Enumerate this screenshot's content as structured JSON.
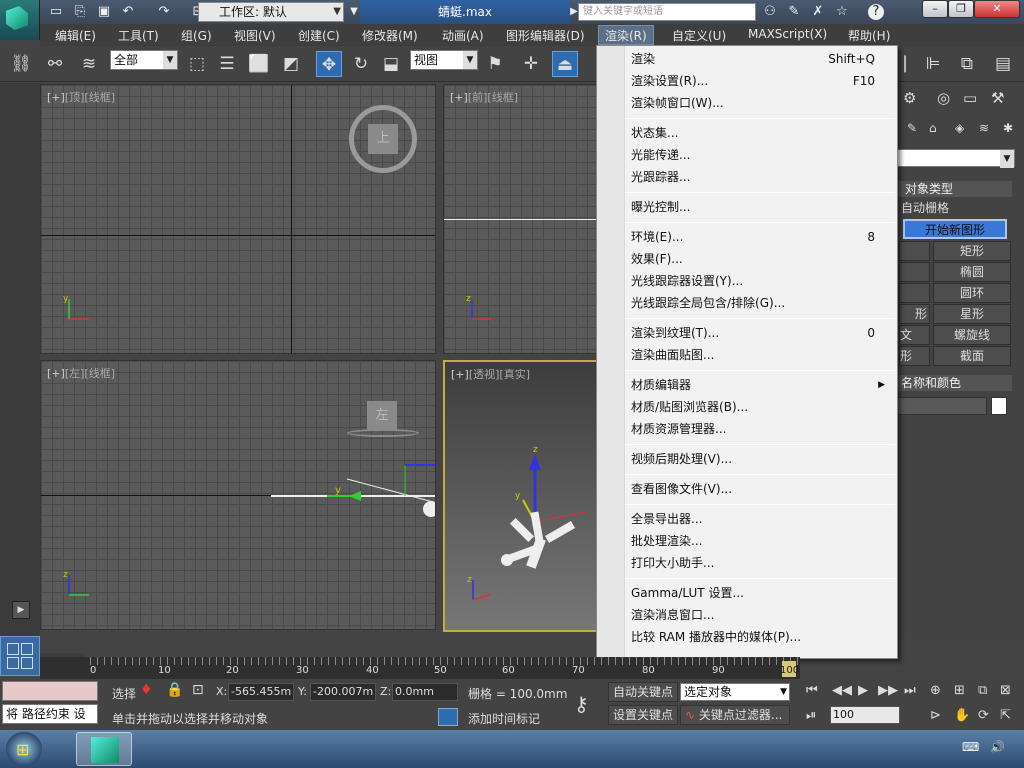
{
  "title_bar": {
    "workspace_label": "工作区: 默认",
    "filename": "蜻蜓.max",
    "search_placeholder": "键入关键字或短语"
  },
  "menu_bar": {
    "items": [
      "编辑(E)",
      "工具(T)",
      "组(G)",
      "视图(V)",
      "创建(C)",
      "修改器(M)",
      "动画(A)",
      "图形编辑器(D)",
      "渲染(R)",
      "自定义(U)",
      "MAXScript(X)",
      "帮助(H)"
    ],
    "active_index": 8
  },
  "toolbar": {
    "selection_filter": "全部",
    "ref_coord": "视图"
  },
  "viewports": {
    "top": {
      "plus": "[+]",
      "name": "[顶]",
      "mode": "[线框]",
      "cube_label": "上"
    },
    "front": {
      "plus": "[+]",
      "name": "[前]",
      "mode": "[线框]"
    },
    "left": {
      "plus": "[+]",
      "name": "[左]",
      "mode": "[线框]",
      "cube_label": "左"
    },
    "perspective": {
      "plus": "[+]",
      "name": "[透视]",
      "mode": "[真实]"
    },
    "axis_labels": {
      "x": "x",
      "y": "y",
      "z": "z"
    }
  },
  "render_menu": {
    "groups": [
      [
        {
          "label": "渲染",
          "shortcut": "Shift+Q"
        },
        {
          "label": "渲染设置(R)...",
          "shortcut": "F10"
        },
        {
          "label": "渲染帧窗口(W)...",
          "shortcut": ""
        }
      ],
      [
        {
          "label": "状态集...",
          "shortcut": ""
        },
        {
          "label": "光能传递...",
          "shortcut": ""
        },
        {
          "label": "光跟踪器...",
          "shortcut": ""
        }
      ],
      [
        {
          "label": "曝光控制...",
          "shortcut": ""
        }
      ],
      [
        {
          "label": "环境(E)...",
          "shortcut": "8"
        },
        {
          "label": "效果(F)...",
          "shortcut": ""
        },
        {
          "label": "光线跟踪器设置(Y)...",
          "shortcut": ""
        },
        {
          "label": "光线跟踪全局包含/排除(G)...",
          "shortcut": ""
        }
      ],
      [
        {
          "label": "渲染到纹理(T)...",
          "shortcut": "0"
        },
        {
          "label": "渲染曲面贴图...",
          "shortcut": ""
        }
      ],
      [
        {
          "label": "材质编辑器",
          "shortcut": "",
          "submenu": true
        },
        {
          "label": "材质/贴图浏览器(B)...",
          "shortcut": ""
        },
        {
          "label": "材质资源管理器...",
          "shortcut": ""
        }
      ],
      [
        {
          "label": "视频后期处理(V)...",
          "shortcut": ""
        }
      ],
      [
        {
          "label": "查看图像文件(V)...",
          "shortcut": ""
        }
      ],
      [
        {
          "label": "全景导出器...",
          "shortcut": ""
        },
        {
          "label": "批处理渲染...",
          "shortcut": ""
        },
        {
          "label": "打印大小助手...",
          "shortcut": ""
        }
      ],
      [
        {
          "label": "Gamma/LUT 设置...",
          "shortcut": ""
        },
        {
          "label": "渲染消息窗口...",
          "shortcut": ""
        },
        {
          "label": "比较 RAM 播放器中的媒体(P)...",
          "shortcut": ""
        }
      ]
    ]
  },
  "command_panel": {
    "object_type_header": "对象类型",
    "auto_grid": "自动栅格",
    "start_new_shape": "开始新图形",
    "shape_buttons": [
      "矩形",
      "椭圆",
      "圆环",
      "星形",
      "螺旋线",
      "截面"
    ],
    "left_partial": [
      "",
      "",
      "",
      "形",
      "文",
      "形"
    ],
    "name_color_header": "名称和颜色"
  },
  "timeline": {
    "ticks": [
      "0",
      "10",
      "20",
      "30",
      "40",
      "50",
      "60",
      "70",
      "80",
      "90",
      "100"
    ]
  },
  "status_bar": {
    "script_line": "将 路径约束 设",
    "select_label": "选择",
    "x_label": "X:",
    "x_value": "-565.455m",
    "y_label": "Y:",
    "y_value": "-200.007m",
    "z_label": "Z:",
    "z_value": "0.0mm",
    "grid_label": "栅格 = 100.0mm",
    "prompt": "单击并拖动以选择并移动对象",
    "add_time_tag": "添加时间标记",
    "auto_key": "自动关键点",
    "set_key": "设置关键点",
    "selected_object": "选定对象",
    "key_filters": "关键点过滤器...",
    "frame_value": "100"
  },
  "colors": {
    "menu_highlight": "#5b6f86",
    "start_shape_bg": "#3a78d8",
    "selection_blue": "#2f6bb0"
  }
}
